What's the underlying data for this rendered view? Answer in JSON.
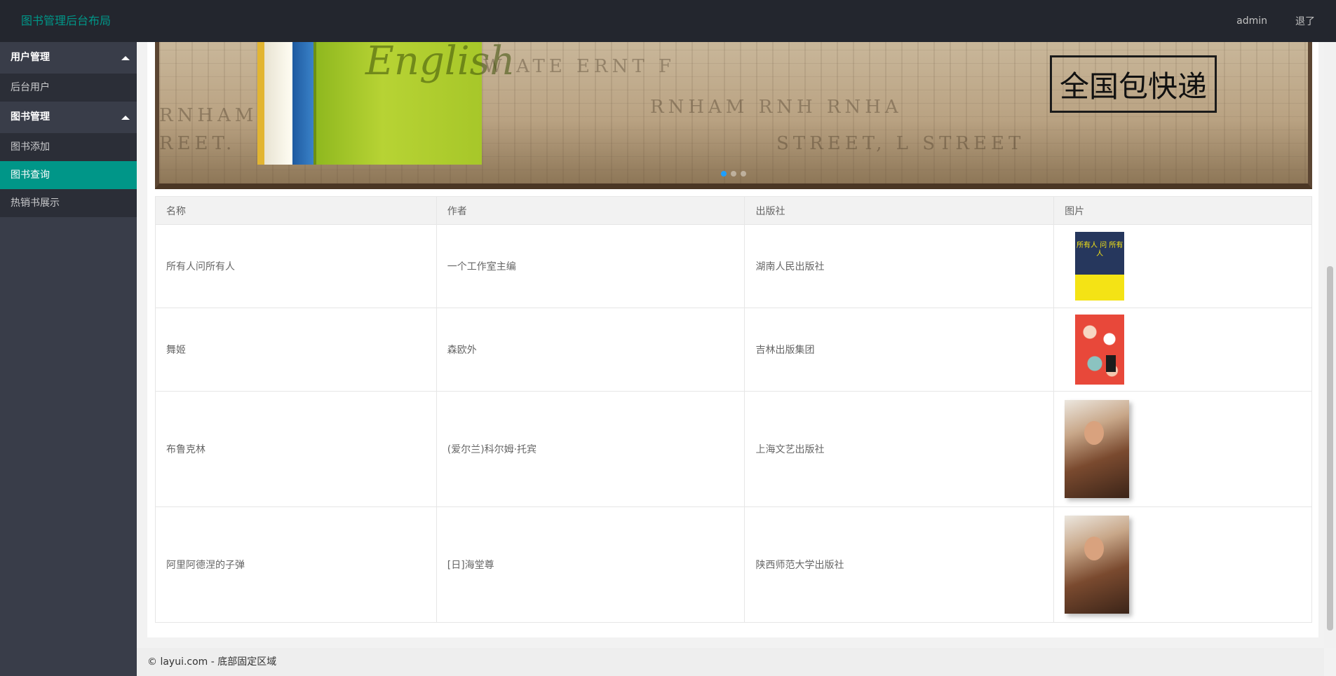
{
  "header": {
    "logo": "图书管理后台布局",
    "user": "admin",
    "logout": "退了"
  },
  "sidebar": {
    "groups": [
      {
        "title": "用户管理",
        "items": [
          "后台用户"
        ]
      },
      {
        "title": "图书管理",
        "items": [
          "图书添加",
          "图书查询",
          "热销书展示"
        ]
      }
    ],
    "active_item": "图书查询"
  },
  "banner": {
    "text": "全国包快递",
    "book_title": "English",
    "active_dot": 0,
    "dots": 3
  },
  "table": {
    "columns": [
      "名称",
      "作者",
      "出版社",
      "图片"
    ],
    "rows": [
      {
        "name": "所有人问所有人",
        "author": "一个工作室主编",
        "publisher": "湖南人民出版社",
        "cover": "所有人 问 所有人"
      },
      {
        "name": "舞姬",
        "author": "森欧外",
        "publisher": "吉林出版集团",
        "cover": ""
      },
      {
        "name": "布鲁克林",
        "author": "(爱尔兰)科尔姆·托宾",
        "publisher": "上海文艺出版社",
        "cover": ""
      },
      {
        "name": "阿里阿德涅的子弹",
        "author": "[日]海堂尊",
        "publisher": "陕西师范大学出版社",
        "cover": ""
      }
    ]
  },
  "footer": {
    "text": "© layui.com - 底部固定区域"
  },
  "colors": {
    "header_bg": "#23262e",
    "sidebar_bg": "#393d49",
    "accent": "#009688"
  }
}
